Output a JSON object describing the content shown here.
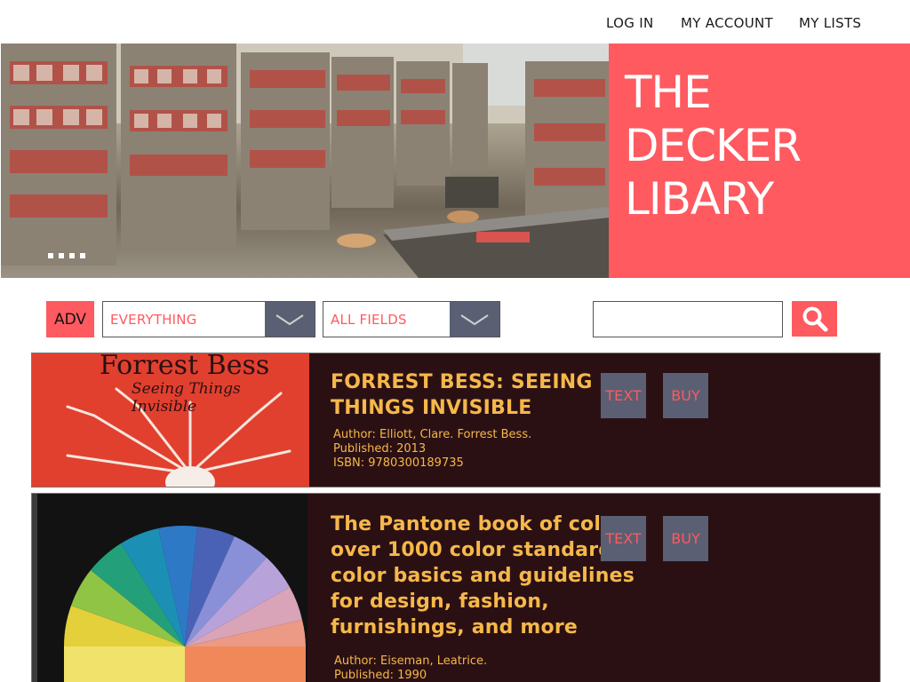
{
  "nav": {
    "login": "LOG IN",
    "account": "MY ACCOUNT",
    "lists": "MY LISTS"
  },
  "hero": {
    "title_lines": [
      "THE",
      "DECKER",
      "LIBARY"
    ],
    "slides": 4
  },
  "search": {
    "adv_label": "ADV",
    "scope_value": "EVERYTHING",
    "field_value": "ALL FIELDS",
    "query_value": "",
    "placeholder": ""
  },
  "results": [
    {
      "title": "FORREST BESS: SEEING THINGS INVISIBLE",
      "title_lines": [
        "FORREST BESS: SEEING",
        "THINGS INVISIBLE"
      ],
      "cover_title": "Forrest Bess",
      "cover_subtitle": "Seeing Things Invisible",
      "author": "Author: Elliott, Clare. Forrest Bess.",
      "published": "Published: 2013",
      "isbn": "ISBN: 9780300189735",
      "text_button": "TEXT",
      "buy_button": "BUY"
    },
    {
      "title": "The Pantone book of color : over 1000 color standards : color basics and guidelines for design, fashion, furnishings, and more",
      "title_lines": [
        "The Pantone book of color :",
        "over 1000 color standards :",
        "color basics and guidelines",
        "for design, fashion,",
        "furnishings, and more"
      ],
      "author": "Author: Eiseman, Leatrice.",
      "published": "Published: 1990",
      "text_button": "TEXT",
      "buy_button": "BUY"
    }
  ],
  "colors": {
    "accent": "#fe5a60",
    "result_bg": "#2b1013",
    "result_text": "#f5b84a",
    "control_gray": "#5a5f73"
  }
}
